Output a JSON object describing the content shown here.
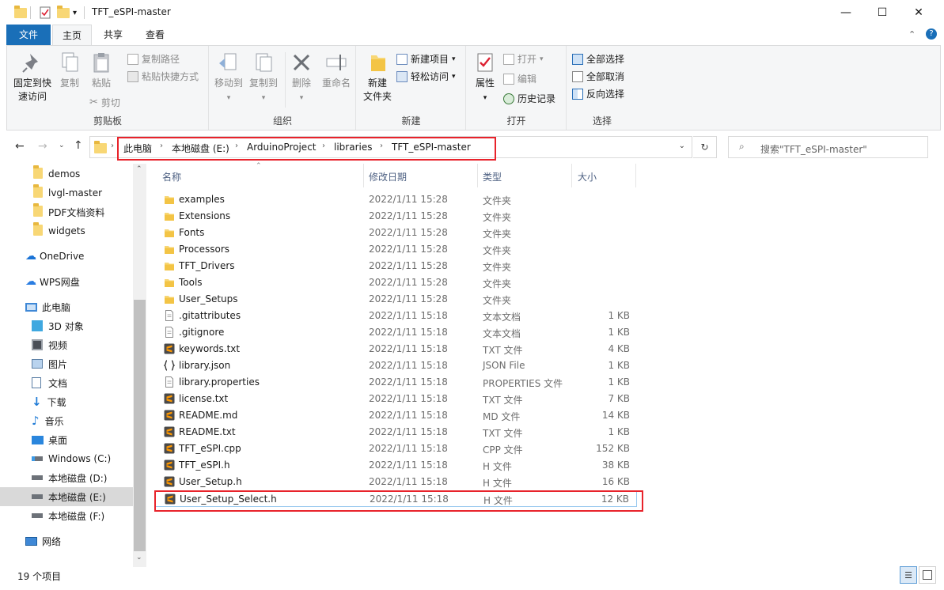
{
  "window": {
    "title": "TFT_eSPI-master",
    "minimize": "—",
    "maximize": "☐",
    "close": "✕"
  },
  "tabs": [
    {
      "label": "文件"
    },
    {
      "label": "主页"
    },
    {
      "label": "共享"
    },
    {
      "label": "查看"
    }
  ],
  "ribbon": {
    "clipboard": {
      "label": "剪贴板",
      "pin": "固定到快\n速访问",
      "copy": "复制",
      "paste": "粘贴",
      "copy_path": "复制路径",
      "paste_shortcut": "粘贴快捷方式",
      "cut": "剪切"
    },
    "organize": {
      "label": "组织",
      "move_to": "移动到",
      "copy_to": "复制到",
      "delete": "删除",
      "rename": "重命名"
    },
    "new": {
      "label": "新建",
      "new_folder": "新建\n文件夹",
      "new_item": "新建项目",
      "easy_access": "轻松访问"
    },
    "open": {
      "label": "打开",
      "properties": "属性",
      "open": "打开",
      "edit": "编辑",
      "history": "历史记录"
    },
    "select": {
      "label": "选择",
      "select_all": "全部选择",
      "select_none": "全部取消",
      "invert": "反向选择"
    }
  },
  "address": {
    "crumbs": [
      "此电脑",
      "本地磁盘 (E:)",
      "ArduinoProject",
      "libraries",
      "TFT_eSPI-master"
    ],
    "search_placeholder": "搜索\"TFT_eSPI-master\""
  },
  "nav": {
    "items": [
      {
        "label": "demos",
        "icon": "folder-icon"
      },
      {
        "label": "lvgl-master",
        "icon": "folder-icon"
      },
      {
        "label": "PDF文档资料",
        "icon": "folder-icon"
      },
      {
        "label": "widgets",
        "icon": "folder-icon"
      },
      {
        "label": "OneDrive",
        "icon": "cloud-icon"
      },
      {
        "label": "WPS网盘",
        "icon": "cloud-icon"
      },
      {
        "label": "此电脑",
        "icon": "computer-icon"
      },
      {
        "label": "3D 对象",
        "icon": "cube-icon"
      },
      {
        "label": "视频",
        "icon": "video-icon"
      },
      {
        "label": "图片",
        "icon": "picture-icon"
      },
      {
        "label": "文档",
        "icon": "document-icon"
      },
      {
        "label": "下载",
        "icon": "download-icon"
      },
      {
        "label": "音乐",
        "icon": "music-icon"
      },
      {
        "label": "桌面",
        "icon": "desktop-icon"
      },
      {
        "label": "Windows (C:)",
        "icon": "drive-icon"
      },
      {
        "label": "本地磁盘 (D:)",
        "icon": "drive-icon"
      },
      {
        "label": "本地磁盘 (E:)",
        "icon": "drive-icon"
      },
      {
        "label": "本地磁盘 (F:)",
        "icon": "drive-icon"
      },
      {
        "label": "网络",
        "icon": "network-icon"
      }
    ]
  },
  "columns": {
    "name": "名称",
    "date": "修改日期",
    "type": "类型",
    "size": "大小"
  },
  "files": [
    {
      "name": "examples",
      "date": "2022/1/11 15:28",
      "type": "文件夹",
      "size": "",
      "icon": "folder"
    },
    {
      "name": "Extensions",
      "date": "2022/1/11 15:28",
      "type": "文件夹",
      "size": "",
      "icon": "folder"
    },
    {
      "name": "Fonts",
      "date": "2022/1/11 15:28",
      "type": "文件夹",
      "size": "",
      "icon": "folder"
    },
    {
      "name": "Processors",
      "date": "2022/1/11 15:28",
      "type": "文件夹",
      "size": "",
      "icon": "folder"
    },
    {
      "name": "TFT_Drivers",
      "date": "2022/1/11 15:28",
      "type": "文件夹",
      "size": "",
      "icon": "folder"
    },
    {
      "name": "Tools",
      "date": "2022/1/11 15:28",
      "type": "文件夹",
      "size": "",
      "icon": "folder"
    },
    {
      "name": "User_Setups",
      "date": "2022/1/11 15:28",
      "type": "文件夹",
      "size": "",
      "icon": "folder"
    },
    {
      "name": ".gitattributes",
      "date": "2022/1/11 15:18",
      "type": "文本文档",
      "size": "1 KB",
      "icon": "text"
    },
    {
      "name": ".gitignore",
      "date": "2022/1/11 15:18",
      "type": "文本文档",
      "size": "1 KB",
      "icon": "text"
    },
    {
      "name": "keywords.txt",
      "date": "2022/1/11 15:18",
      "type": "TXT 文件",
      "size": "4 KB",
      "icon": "sublime"
    },
    {
      "name": "library.json",
      "date": "2022/1/11 15:18",
      "type": "JSON File",
      "size": "1 KB",
      "icon": "json"
    },
    {
      "name": "library.properties",
      "date": "2022/1/11 15:18",
      "type": "PROPERTIES 文件",
      "size": "1 KB",
      "icon": "text"
    },
    {
      "name": "license.txt",
      "date": "2022/1/11 15:18",
      "type": "TXT 文件",
      "size": "7 KB",
      "icon": "sublime"
    },
    {
      "name": "README.md",
      "date": "2022/1/11 15:18",
      "type": "MD 文件",
      "size": "14 KB",
      "icon": "sublime"
    },
    {
      "name": "README.txt",
      "date": "2022/1/11 15:18",
      "type": "TXT 文件",
      "size": "1 KB",
      "icon": "sublime"
    },
    {
      "name": "TFT_eSPI.cpp",
      "date": "2022/1/11 15:18",
      "type": "CPP 文件",
      "size": "152 KB",
      "icon": "sublime"
    },
    {
      "name": "TFT_eSPI.h",
      "date": "2022/1/11 15:18",
      "type": "H 文件",
      "size": "38 KB",
      "icon": "sublime"
    },
    {
      "name": "User_Setup.h",
      "date": "2022/1/11 15:18",
      "type": "H 文件",
      "size": "16 KB",
      "icon": "sublime"
    },
    {
      "name": "User_Setup_Select.h",
      "date": "2022/1/11 15:18",
      "type": "H 文件",
      "size": "12 KB",
      "icon": "sublime"
    }
  ],
  "status": {
    "count": "19 个项目"
  },
  "colors": {
    "accent": "#1a6fb8",
    "highlight": "#e8232b",
    "folder": "#f8d775",
    "sublime": "#ff9800"
  }
}
